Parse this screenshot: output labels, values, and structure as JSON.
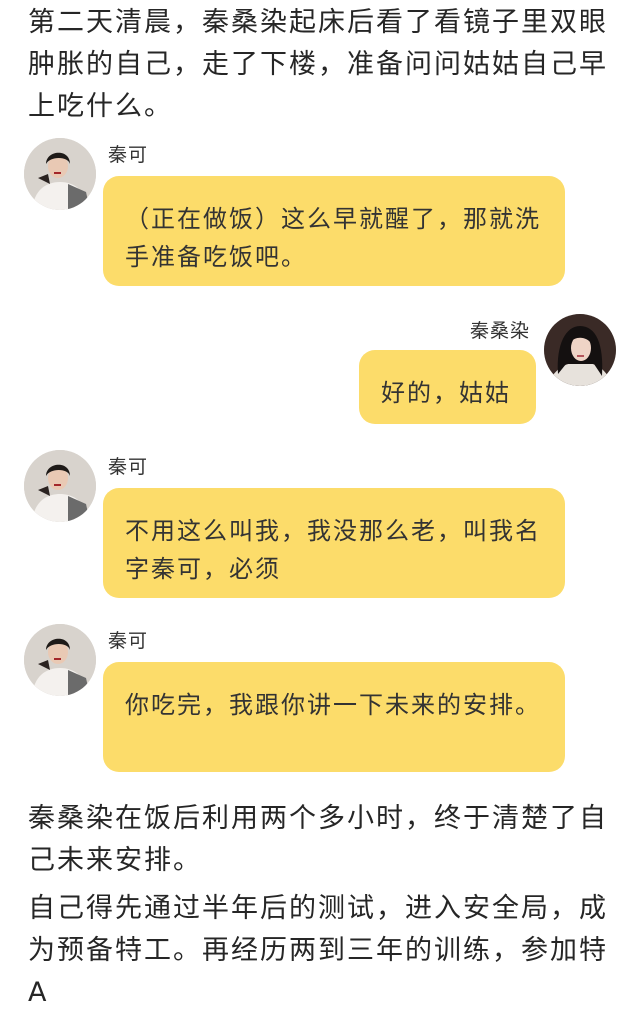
{
  "narration": {
    "p1": "第二天清晨，秦桑染起床后看了看镜子里双眼肿胀的自己，走了下楼，准备问问姑姑自己早上吃什么。",
    "p2": "秦桑染在饭后利用两个多小时，终于清楚了自己未来安排。",
    "p3": "自己得先通过半年后的测试，进入安全局，成为预备特工。再经历两到三年的训练，参加特A"
  },
  "messages": [
    {
      "sender": "秦可",
      "side": "left",
      "text": "（正在做饭）这么早就醒了，那就洗手准备吃饭吧。"
    },
    {
      "sender": "秦桑染",
      "side": "right",
      "text": "好的，姑姑"
    },
    {
      "sender": "秦可",
      "side": "left",
      "text": "不用这么叫我，我没那么老，叫我名字秦可，必须"
    },
    {
      "sender": "秦可",
      "side": "left",
      "text": "你吃完，我跟你讲一下未来的安排。"
    }
  ],
  "colors": {
    "bubble": "#fcdc6a",
    "background": "#ffffff",
    "text": "#262626"
  }
}
